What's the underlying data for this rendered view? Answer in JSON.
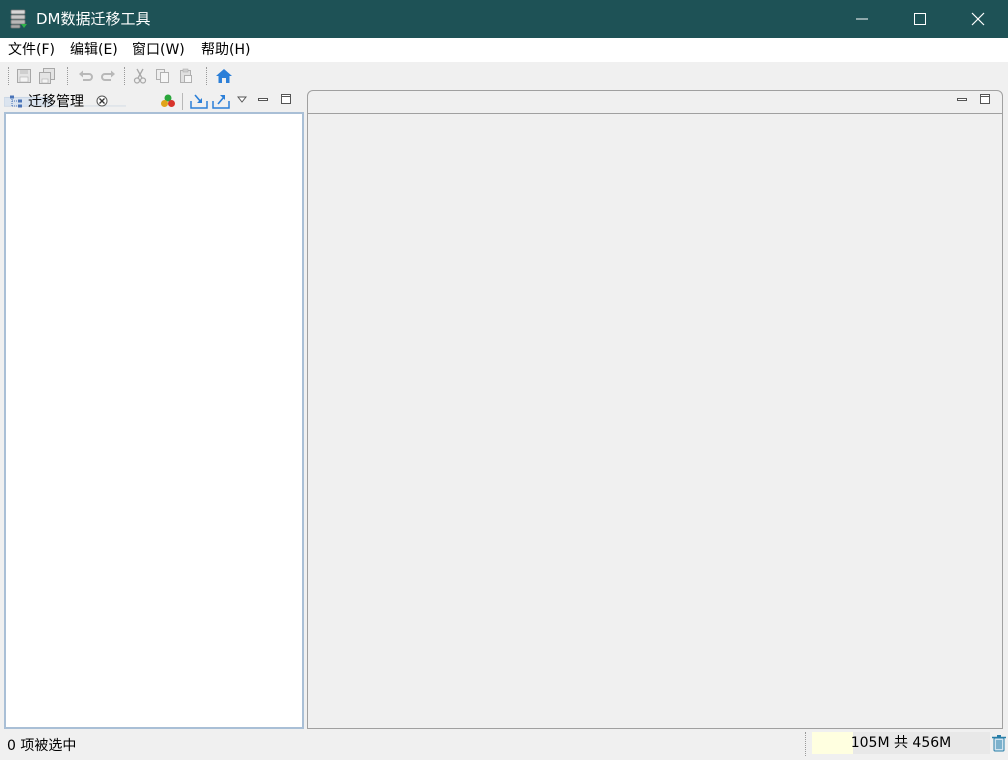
{
  "window": {
    "title": "DM数据迁移工具",
    "app_icon": "database-stack-icon",
    "controls": [
      "minimize-icon",
      "maximize-icon",
      "close-icon"
    ],
    "titlebar_color": "#1e5256"
  },
  "menubar": {
    "items": [
      {
        "label": "文件(F)"
      },
      {
        "label": "编辑(E)"
      },
      {
        "label": "窗口(W)"
      },
      {
        "label": "帮助(H)"
      }
    ]
  },
  "toolbar": {
    "buttons": [
      {
        "icon": "save-icon",
        "enabled": false
      },
      {
        "icon": "save-all-icon",
        "enabled": false
      },
      {
        "icon": "undo-icon",
        "enabled": false
      },
      {
        "icon": "redo-icon",
        "enabled": false
      },
      {
        "icon": "cut-icon",
        "enabled": false
      },
      {
        "icon": "copy-icon",
        "enabled": false
      },
      {
        "icon": "paste-icon",
        "enabled": false
      },
      {
        "icon": "home-icon",
        "enabled": true
      }
    ]
  },
  "left_panel": {
    "tab_label": "迁移管理",
    "tab_icon": "tree-icon",
    "actions": [
      "color-circles-icon",
      "import-icon",
      "export-icon",
      "view-menu-icon",
      "minimize-icon",
      "maximize-icon"
    ]
  },
  "right_panel": {
    "actions": [
      "minimize-icon",
      "maximize-icon"
    ]
  },
  "statusbar": {
    "selection_text": "0 项被选中",
    "memory_text": "105M 共 456M",
    "memory_used": 105,
    "memory_total": 456,
    "gc_icon": "trash-icon"
  }
}
